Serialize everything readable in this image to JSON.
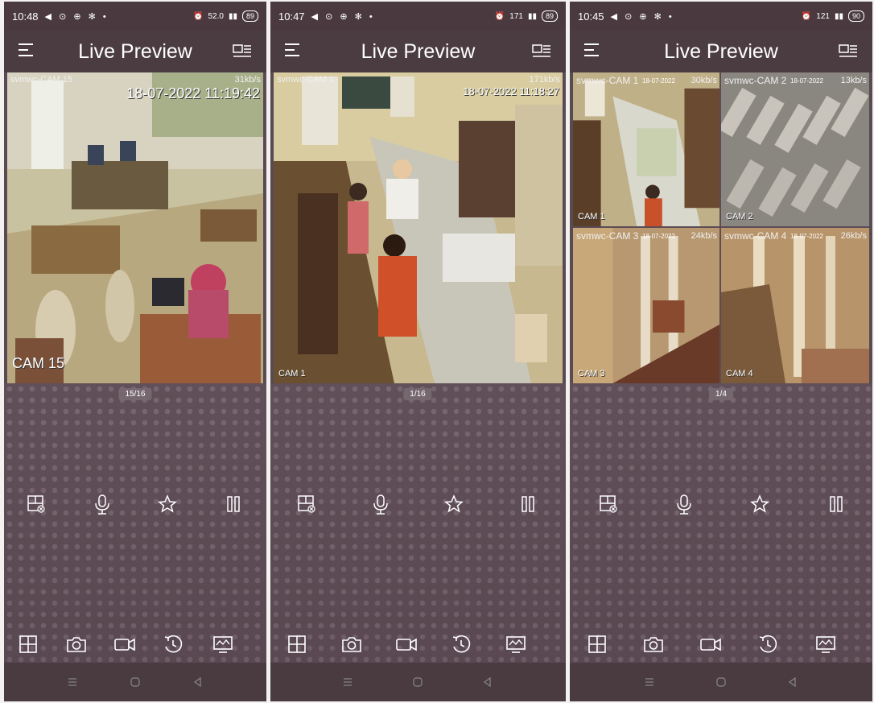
{
  "phones": [
    {
      "status": {
        "time": "10:48",
        "right": "52.0",
        "battery": "89"
      },
      "header": {
        "title": "Live Preview"
      },
      "layout": "single",
      "feeds": [
        {
          "name": "svmwc-CAM 15",
          "rate": "31kb/s",
          "timestamp": "18-07-2022 11:19:42",
          "cam_label": "CAM 15"
        }
      ],
      "page_indicator": "15/16"
    },
    {
      "status": {
        "time": "10:47",
        "right": "171",
        "battery": "89"
      },
      "header": {
        "title": "Live Preview"
      },
      "layout": "single",
      "feeds": [
        {
          "name": "svmwc-CAM 1",
          "rate": "171kb/s",
          "timestamp": "18-07-2022 11:18:27",
          "cam_label": "CAM 1"
        }
      ],
      "page_indicator": "1/16"
    },
    {
      "status": {
        "time": "10:45",
        "right": "121",
        "battery": "90"
      },
      "header": {
        "title": "Live Preview"
      },
      "layout": "quad",
      "feeds": [
        {
          "name": "svmwc-CAM 1",
          "rate": "30kb/s",
          "timestamp": "18-07-2022",
          "cam_label": "CAM 1"
        },
        {
          "name": "svmwc-CAM 2",
          "rate": "13kb/s",
          "timestamp": "18-07-2022",
          "cam_label": "CAM 2"
        },
        {
          "name": "svmwc-CAM 3",
          "rate": "24kb/s",
          "timestamp": "18-07-2022",
          "cam_label": "CAM 3"
        },
        {
          "name": "svmwc-CAM 4",
          "rate": "26kb/s",
          "timestamp": "18-07-2022",
          "cam_label": "CAM 4"
        }
      ],
      "page_indicator": "1/4"
    }
  ],
  "controls": [
    "split-window-icon",
    "microphone-icon",
    "star-icon",
    "pause-icon"
  ],
  "toolbar": [
    "grid-layout-icon",
    "camera-icon",
    "video-record-icon",
    "playback-icon",
    "monitor-icon"
  ],
  "navbar": [
    "menu-icon",
    "home-icon",
    "back-icon"
  ],
  "colors": {
    "chrome": "#4b3c42",
    "background": "#5d4c55",
    "accent": "#ffffff"
  }
}
